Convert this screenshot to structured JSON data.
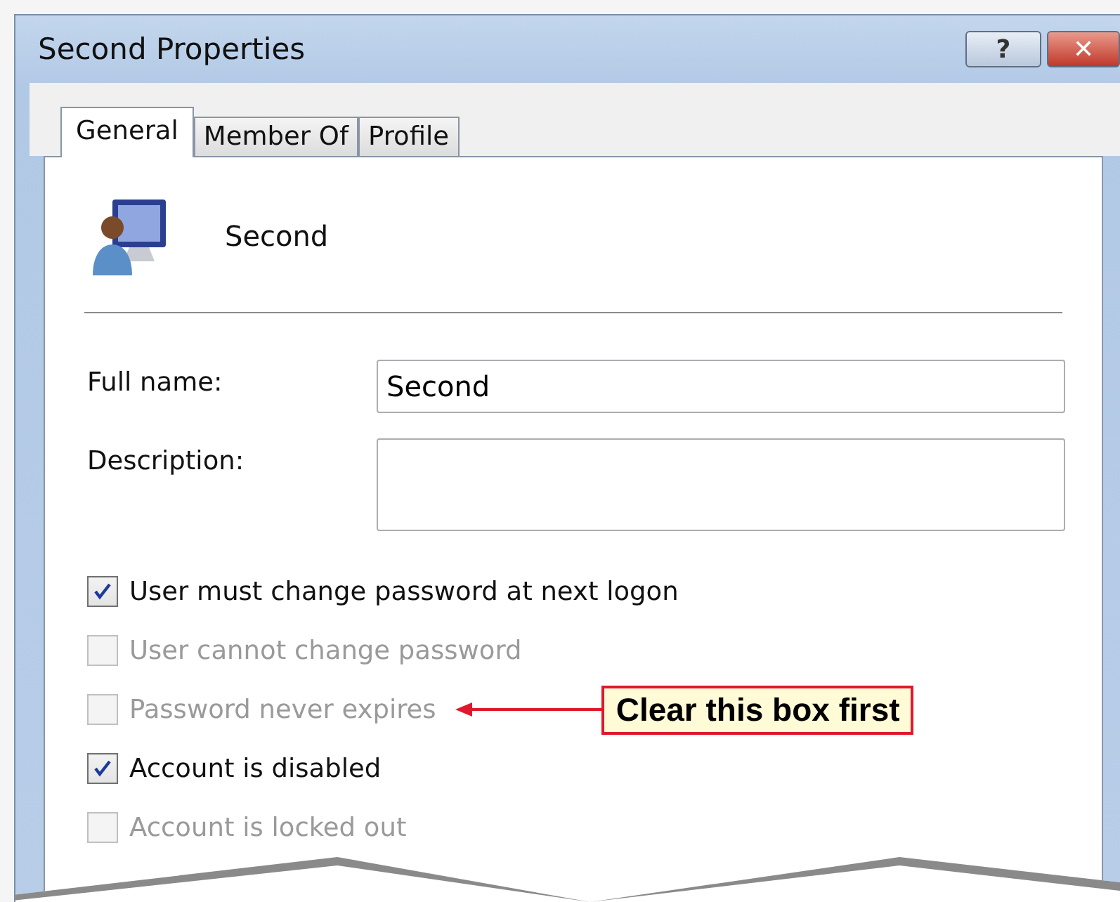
{
  "window": {
    "title": "Second Properties",
    "buttons": [
      "?",
      "✕"
    ]
  },
  "tabs": [
    {
      "label": "General",
      "selected": true
    },
    {
      "label": "Member Of",
      "selected": false
    },
    {
      "label": "Profile",
      "selected": false
    }
  ],
  "header": {
    "name": "Second"
  },
  "fields": [
    {
      "label": "Full name:",
      "kind": "line",
      "value": "Second"
    },
    {
      "label": "Description:",
      "kind": "area"
    }
  ],
  "options": [
    {
      "label": "User must change password at next logon",
      "checked": true,
      "disabled": false
    },
    {
      "label": "User cannot change password",
      "checked": false,
      "disabled": true
    },
    {
      "label": "Password never expires",
      "checked": false,
      "disabled": true,
      "annotation": "Clear this box first"
    },
    {
      "label": "Account is disabled",
      "checked": true,
      "disabled": false
    },
    {
      "label": "Account is locked out",
      "checked": false,
      "disabled": true
    }
  ]
}
